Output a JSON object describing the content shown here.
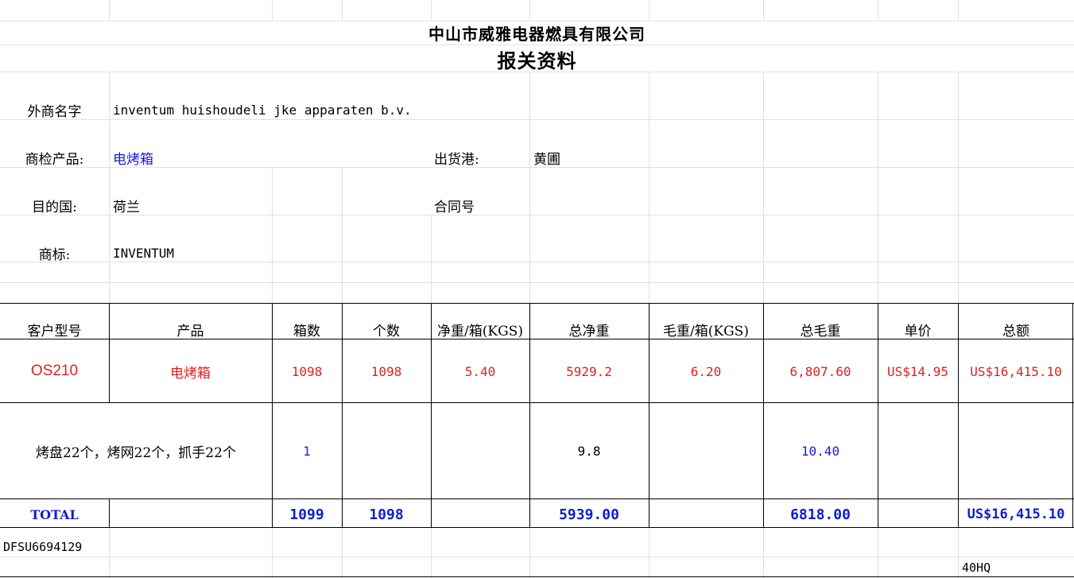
{
  "company_name": "中山市威雅电器燃具有限公司",
  "doc_title": "报关资料",
  "info": {
    "buyer_label": "外商名字",
    "buyer_value": "inventum huishoudeli jke apparaten b.v.",
    "product_label": "商检产品:",
    "product_value": "电烤箱",
    "port_label": "出货港:",
    "port_value": "黄圃",
    "country_label": "目的国:",
    "country_value": "荷兰",
    "contract_label": "合同号",
    "brand_label": "商标:",
    "brand_value": "INVENTUM"
  },
  "table": {
    "headers": [
      "客户型号",
      "产品",
      "箱数",
      "个数",
      "净重/箱(KGS)",
      "总净重",
      "毛重/箱(KGS)",
      "总毛重",
      "单价",
      "总额"
    ],
    "row1": [
      "OS210",
      "电烤箱",
      "1098",
      "1098",
      "5.40",
      "5929.2",
      "6.20",
      "6,807.60",
      "US$14.95",
      "US$16,415.10"
    ],
    "row2": {
      "desc": "烤盘22个，烤网22个，抓手22个",
      "boxes": "1",
      "net_total": "9.8",
      "gross_total": "10.40"
    },
    "total": {
      "label": "TOTAL",
      "boxes": "1099",
      "pieces": "1098",
      "net_total": "5939.00",
      "gross_total": "6818.00",
      "amount": "US$16,415.10"
    }
  },
  "footer": {
    "container_no": "DFSU6694129",
    "container_type": "40HQ"
  },
  "colors": {
    "red": "#e02020",
    "blue": "#1a1adf",
    "grid": "#e1e1e1",
    "border": "#000000"
  }
}
